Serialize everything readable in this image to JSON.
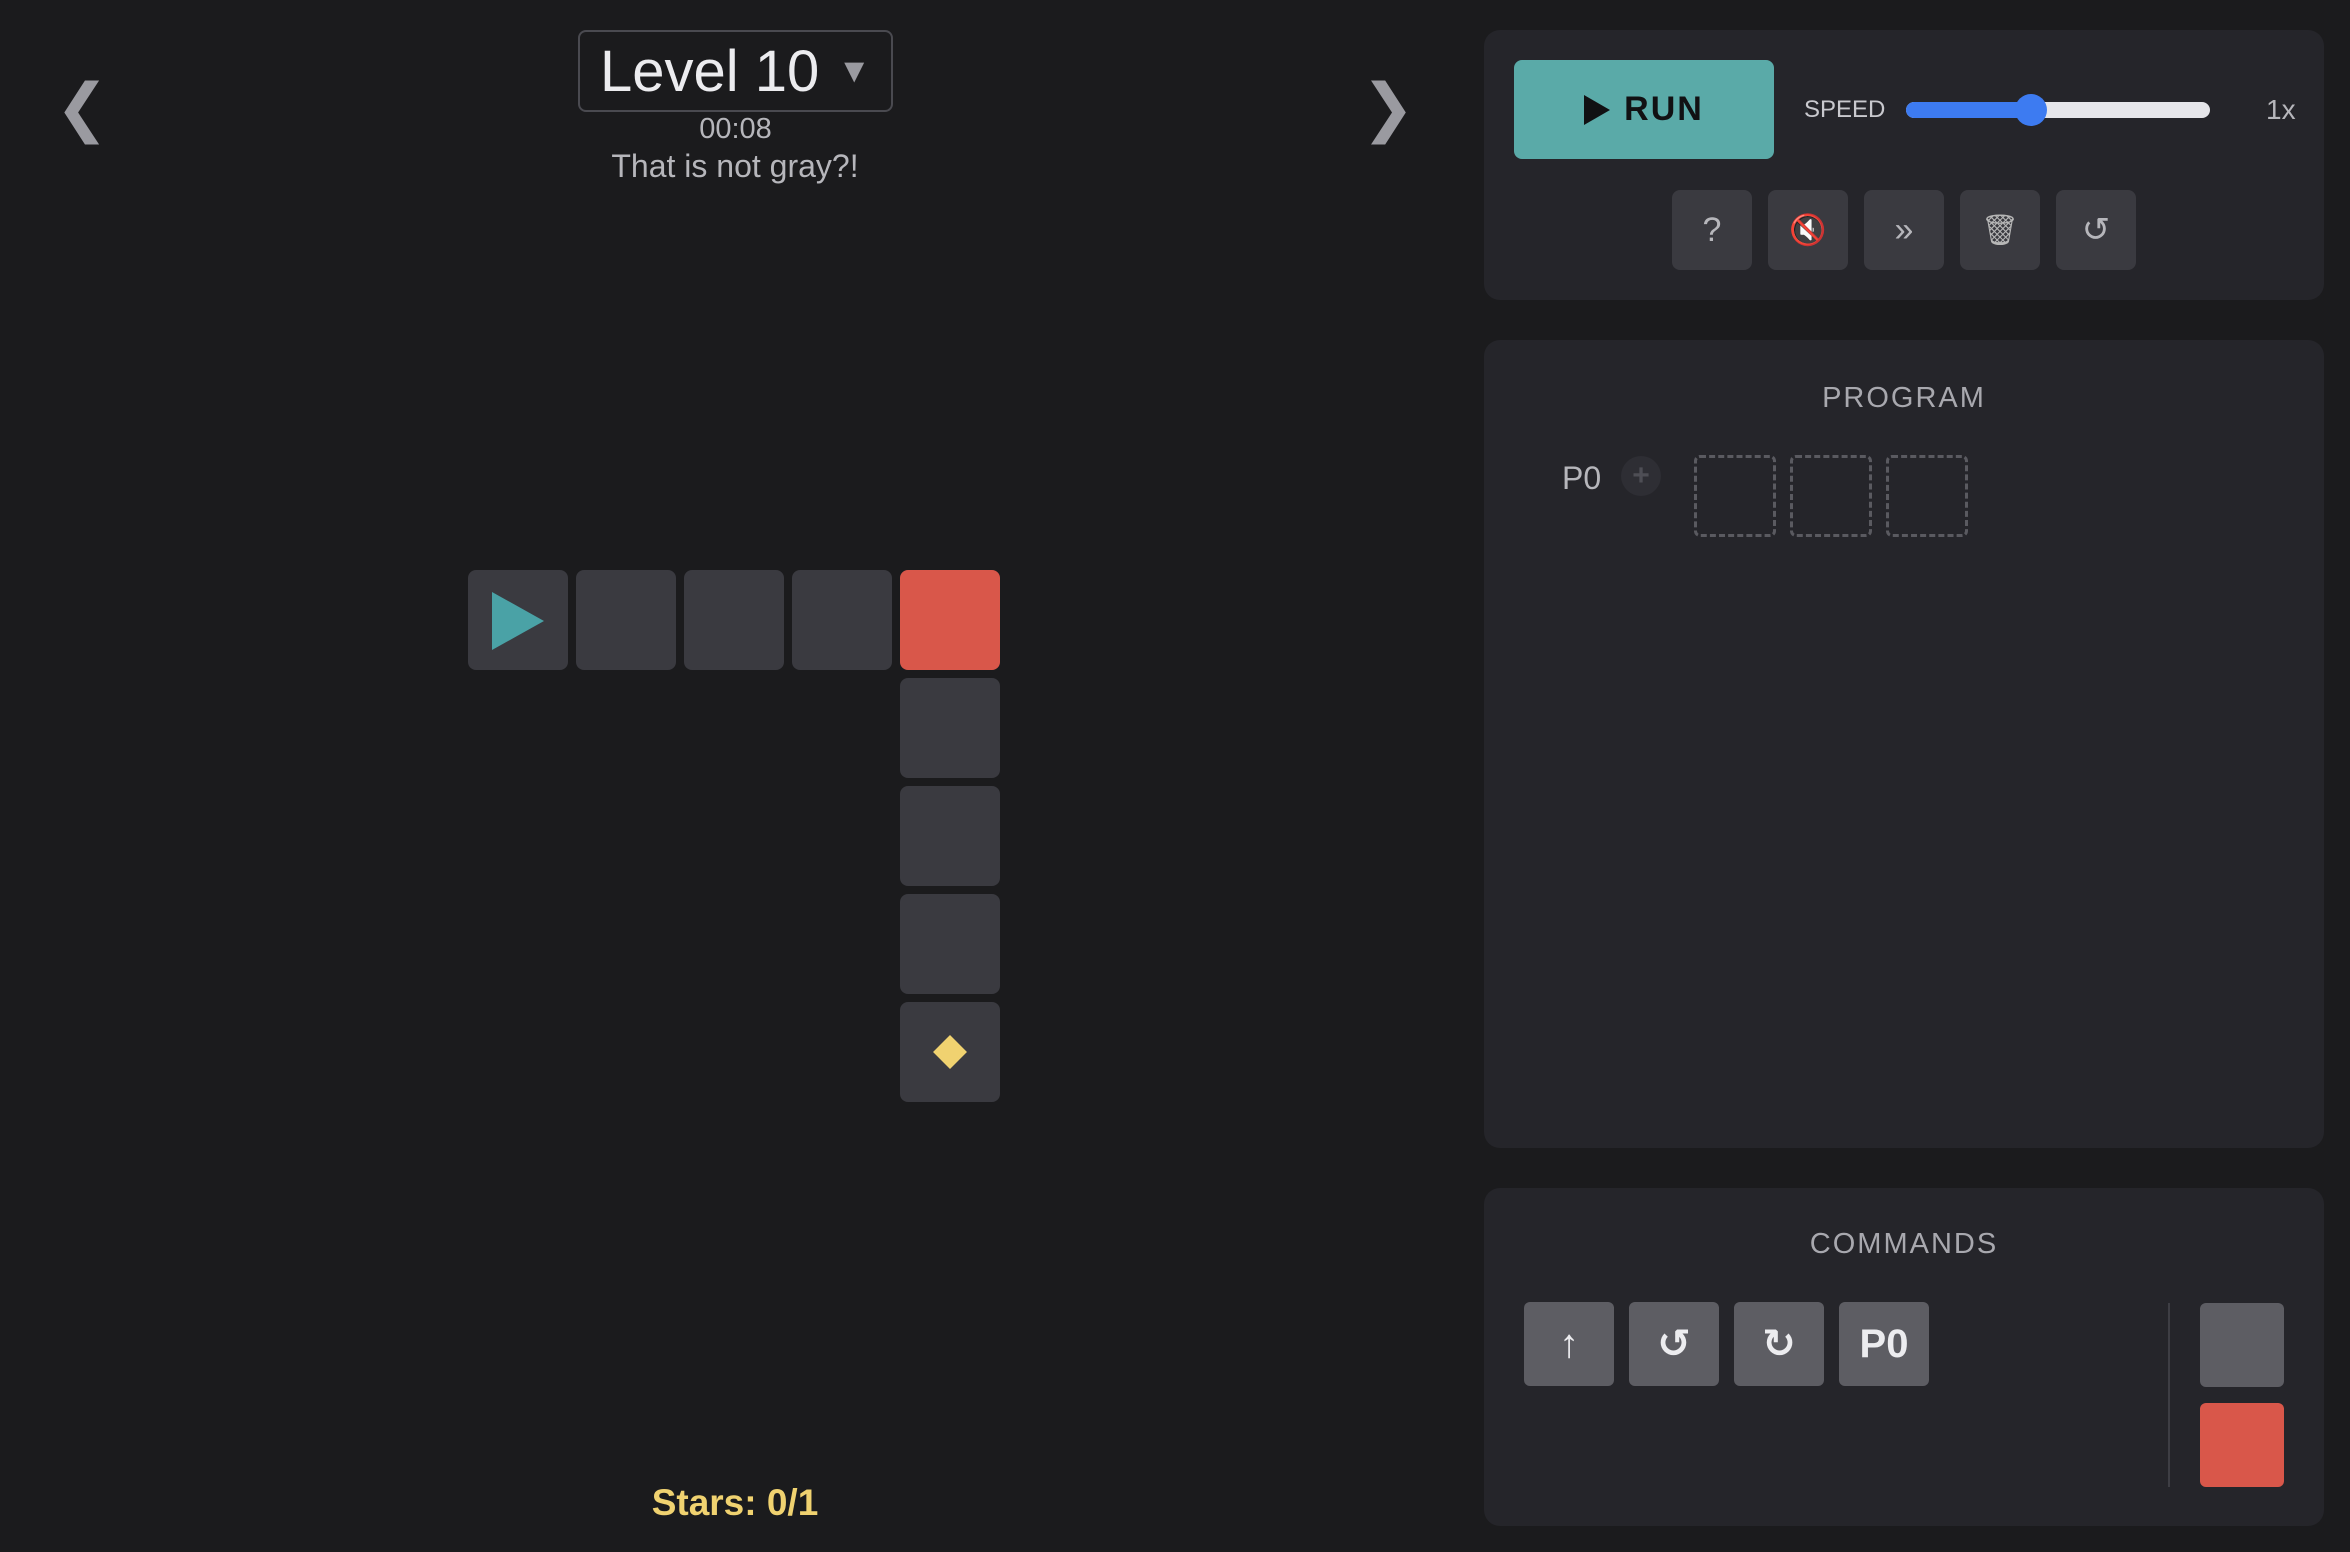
{
  "header": {
    "prev_arrow": "❮",
    "next_arrow": "❯",
    "level_label": "Level 10",
    "level_caret": "▼",
    "timer": "00:08",
    "hint": "That is not gray?!"
  },
  "board": {
    "tiles": [
      {
        "row": 0,
        "col": 0,
        "color": "gray",
        "content": "robot"
      },
      {
        "row": 0,
        "col": 1,
        "color": "gray",
        "content": ""
      },
      {
        "row": 0,
        "col": 2,
        "color": "gray",
        "content": ""
      },
      {
        "row": 0,
        "col": 3,
        "color": "gray",
        "content": ""
      },
      {
        "row": 0,
        "col": 4,
        "color": "red",
        "content": ""
      },
      {
        "row": 1,
        "col": 4,
        "color": "gray",
        "content": ""
      },
      {
        "row": 2,
        "col": 4,
        "color": "gray",
        "content": ""
      },
      {
        "row": 3,
        "col": 4,
        "color": "gray",
        "content": ""
      },
      {
        "row": 4,
        "col": 4,
        "color": "gray",
        "content": "star"
      }
    ]
  },
  "stars_text": "Stars: 0/1",
  "controls": {
    "run_label": "RUN",
    "speed_label": "SPEED",
    "speed_level": 0.41,
    "speed_value": "1x",
    "tools": [
      {
        "name": "help-button",
        "glyph": "?"
      },
      {
        "name": "mute-button",
        "glyph": "🔇"
      },
      {
        "name": "fast-forward-button",
        "glyph": "»"
      },
      {
        "name": "clear-button",
        "glyph": "🗑"
      },
      {
        "name": "reset-button",
        "glyph": "↺"
      }
    ]
  },
  "program": {
    "title": "PROGRAM",
    "function_label": "P0",
    "add_glyph": "+",
    "slots": 3
  },
  "commands": {
    "title": "COMMANDS",
    "buttons": [
      {
        "name": "forward-command",
        "glyph": "↑"
      },
      {
        "name": "turn-left-command",
        "glyph": "↺"
      },
      {
        "name": "turn-right-command",
        "glyph": "↻"
      },
      {
        "name": "call-p0-command",
        "glyph": "P0"
      }
    ],
    "colors": [
      "#5d5d63",
      "#d9574a"
    ]
  },
  "colors": {
    "background": "#1b1b1d",
    "panel": "#25252a",
    "tile_gray": "#3a3a40",
    "tile_red": "#d9574a",
    "accent_teal": "#5aaaa8",
    "star_yellow": "#f0d270",
    "slider_blue": "#3d7bf1"
  }
}
